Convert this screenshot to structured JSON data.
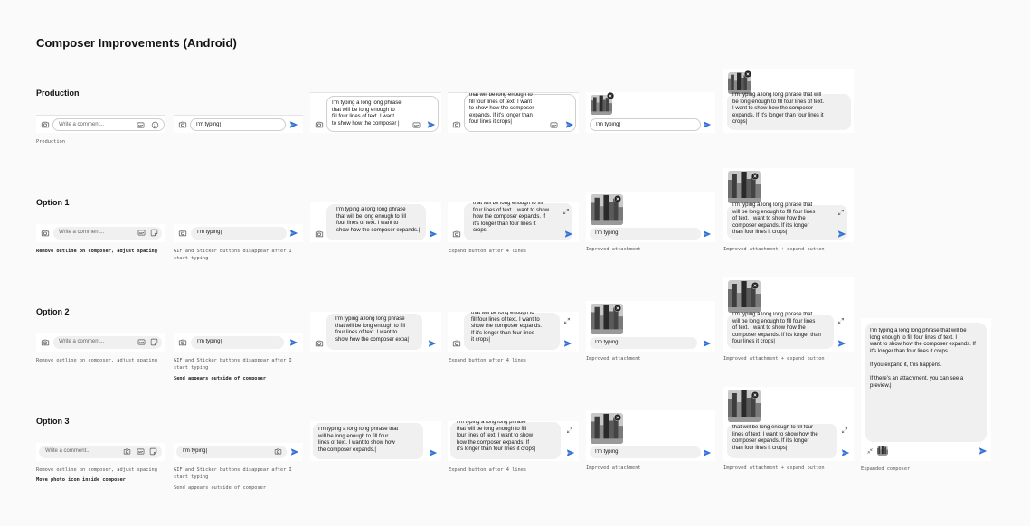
{
  "page": {
    "title": "Composer Improvements (Android)"
  },
  "rows": {
    "production": "Production",
    "option1": "Option 1",
    "option2": "Option 2",
    "option3": "Option 3"
  },
  "composer": {
    "placeholder": "Write a comment...",
    "typing": "I'm typing|",
    "gif_label": "GIF"
  },
  "texts": {
    "prod_3lines": "I'm typing a long long phrase\nthat will be long enough to\nfill four lines of text. I want\nto show how the composer |",
    "prod_scroll": "that will be long enough to\nfill four lines of text. I want\nto show how the composer\nexpands. If it's longer than\nfour lines it crops|",
    "prod_attach_full": "I'm typing a long long phrase that will\nbe long enough to fill four lines of text.\nI want to show how the composer\nexpands. If it's longer than four lines it\ncrops|",
    "o1_3lines": "I'm typing a long long phrase\nthat will be long enough to fill\nfour lines of text. I want to\nshow how the composer expands.|",
    "o1_scroll": "that will be long enough to fill\nfour lines of text. I want to show\nhow the composer expands. If\nit's longer than four lines it\ncrops|",
    "o1_attach_full": "I'm typing a long long phrase that\nwill be long enough to fill four lines\nof text. I want to show how the\ncomposer expands. If it's longer\nthan four lines it crops|",
    "o2_3lines": "I'm typing a long long phrase\nthat will be long enough to fill\nfour lines of text. I want to\nshow how the composer expa|",
    "o2_scroll": "that will be long enough to\nfill four lines of text. I want to\nshow the composer expands.\nIf it's longer than four lines\nit crops|",
    "o2_attach_full": "I'm typing a long long phrase that\nwill be long enough to fill four lines\nof text. I want to show how the\ncomposer expands. If it's longer than\nfour lines it crops|",
    "o3_3lines": "I'm typing a long long phrase that\nwill be long enough to fill four\nlines of text. I want to show how\nthe composer expands.|",
    "o3_scroll": "I'm typing a long long phrase\nthat will be long enough to fill\nfour lines of text. I want to show\nhow the composer expands. If\nit's longer than four lines it crops|",
    "o3_attach_full": "that will be long enough to fill four\nlines of text. I want to show how the\ncomposer expands. If it's longer\nthan four lines it crops|",
    "expanded": "I'm typing a long long phrase that will be\nlong enough to fill four lines of text. I\nwant to show how the composer expands. If\nit's longer than four lines it crops.\n\nIf you expand it, this happens.\n\nIf there's an attachment, you can see a\npreview.|"
  },
  "captions": {
    "production": "Production",
    "remove_outline": "Remove outline on composer, adjust spacing",
    "gif_disappear": "GIF and Sticker buttons disappear after I\nstart typing",
    "send_outside": "Send appears outside of composer",
    "expand_4lines": "Expand button after 4 lines",
    "improved_attachment": "Improved attachment",
    "improved_expand": "Improved attachment + expand button",
    "move_photo": "Move photo icon inside composer",
    "expanded_composer": "Expanded composer"
  },
  "colors": {
    "accent": "#2d6fd6",
    "pill": "#f0f0f0",
    "text": "#111111",
    "caption": "#555555"
  },
  "icons": [
    "camera-icon",
    "gif-icon",
    "smiley-icon",
    "sticker-icon",
    "send-icon",
    "expand-icon",
    "collapse-icon",
    "close-icon"
  ]
}
